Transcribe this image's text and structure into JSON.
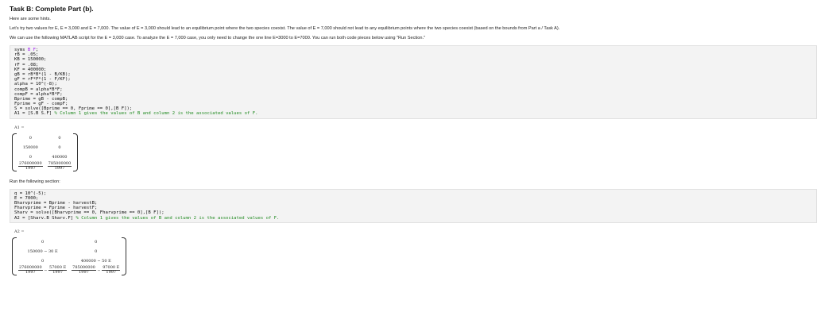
{
  "title": "Task B: Complete Part (b).",
  "hints": "Here are some hints.",
  "para1": "Let's try two values for E, E = 3,000 and E = 7,000. The value of E = 3,000 should lead to an equilibrium point where the two species coexist. The value of E = 7,000 should not lead to any equilibrium points where the two species coexist (based on the bounds from Part a / Task A).",
  "para2": "We can use the following MATLAB script for the E = 3,000 case. To analyze the E = 7,000 case, you only need to change the one line E=3000 to E=7000. You can run both code pieces below using \"Run Section.\"",
  "code1": {
    "lines": [
      {
        "pre": "syms ",
        "kw": "B F",
        "post": ";",
        "cm": ""
      },
      {
        "pre": "rB = .05;",
        "kw": "",
        "post": "",
        "cm": ""
      },
      {
        "pre": "KB = 150000;",
        "kw": "",
        "post": "",
        "cm": ""
      },
      {
        "pre": "rF = .08;",
        "kw": "",
        "post": "",
        "cm": ""
      },
      {
        "pre": "KF = 400000;",
        "kw": "",
        "post": "",
        "cm": ""
      },
      {
        "pre": "gB = rB*B*(1 - B/KB);",
        "kw": "",
        "post": "",
        "cm": ""
      },
      {
        "pre": "gF = rF*F*(1 - F/KF);",
        "kw": "",
        "post": "",
        "cm": ""
      },
      {
        "pre": "alpha = 10^(-8);",
        "kw": "",
        "post": "",
        "cm": ""
      },
      {
        "pre": "compB = alpha*B*F;",
        "kw": "",
        "post": "",
        "cm": ""
      },
      {
        "pre": "compF = alpha*B*F;",
        "kw": "",
        "post": "",
        "cm": ""
      },
      {
        "pre": "Bprime = gB - compB;",
        "kw": "",
        "post": "",
        "cm": ""
      },
      {
        "pre": "Fprime = gF - compF;",
        "kw": "",
        "post": "",
        "cm": ""
      },
      {
        "pre": "S = solve([Bprime == 0, Fprime == 0],[B F]);",
        "kw": "",
        "post": "",
        "cm": ""
      },
      {
        "pre": "A1 = [S.B S.F] ",
        "kw": "",
        "post": "",
        "cm": "% Column 1 gives the values of B and column 2 is the associated values of F."
      }
    ]
  },
  "out1": {
    "label": "A1 =",
    "rows": [
      [
        {
          "t": "0"
        },
        {
          "t": "0"
        }
      ],
      [
        {
          "t": "150000"
        },
        {
          "t": "0"
        }
      ],
      [
        {
          "t": "0"
        },
        {
          "t": "400000"
        }
      ],
      [
        {
          "num": "276000000",
          "den": "1997"
        },
        {
          "num": "785000000",
          "den": "1997"
        }
      ]
    ]
  },
  "run_label": "Run the following section:",
  "code2": {
    "lines": [
      {
        "pre": "q = 10^(-5);",
        "kw": "",
        "post": "",
        "cm": ""
      },
      {
        "pre": "E = 7000;",
        "kw": "",
        "post": "",
        "cm": ""
      },
      {
        "pre": "Bharvprime = Bprime - harvestB;",
        "kw": "",
        "post": "",
        "cm": ""
      },
      {
        "pre": "Fharvprime = Fprime - harvestF;",
        "kw": "",
        "post": "",
        "cm": ""
      },
      {
        "pre": "Sharv = solve([Bharvprime == 0, Fharvprime == 0],[B F]);",
        "kw": "",
        "post": "",
        "cm": ""
      },
      {
        "pre": "A2 = [Sharv.B Sharv.F] ",
        "kw": "",
        "post": "",
        "cm": "% Column 1 gives the values of B and column 2 is the associated values of F."
      }
    ]
  },
  "out2": {
    "label": "A2 =",
    "rows": [
      [
        {
          "t": "0"
        },
        {
          "t": "0"
        }
      ],
      [
        {
          "t": "150000 − 30 E"
        },
        {
          "t": "0"
        }
      ],
      [
        {
          "t": "0"
        },
        {
          "t": "400000 − 50 E"
        }
      ],
      [
        {
          "num": "276000000",
          "den": "1997",
          "op": "−",
          "num2": "57000 E",
          "den2": "1997"
        },
        {
          "num": "785000000",
          "den": "1997",
          "op": "−",
          "num2": "97000 E",
          "den2": "1997"
        }
      ]
    ]
  }
}
